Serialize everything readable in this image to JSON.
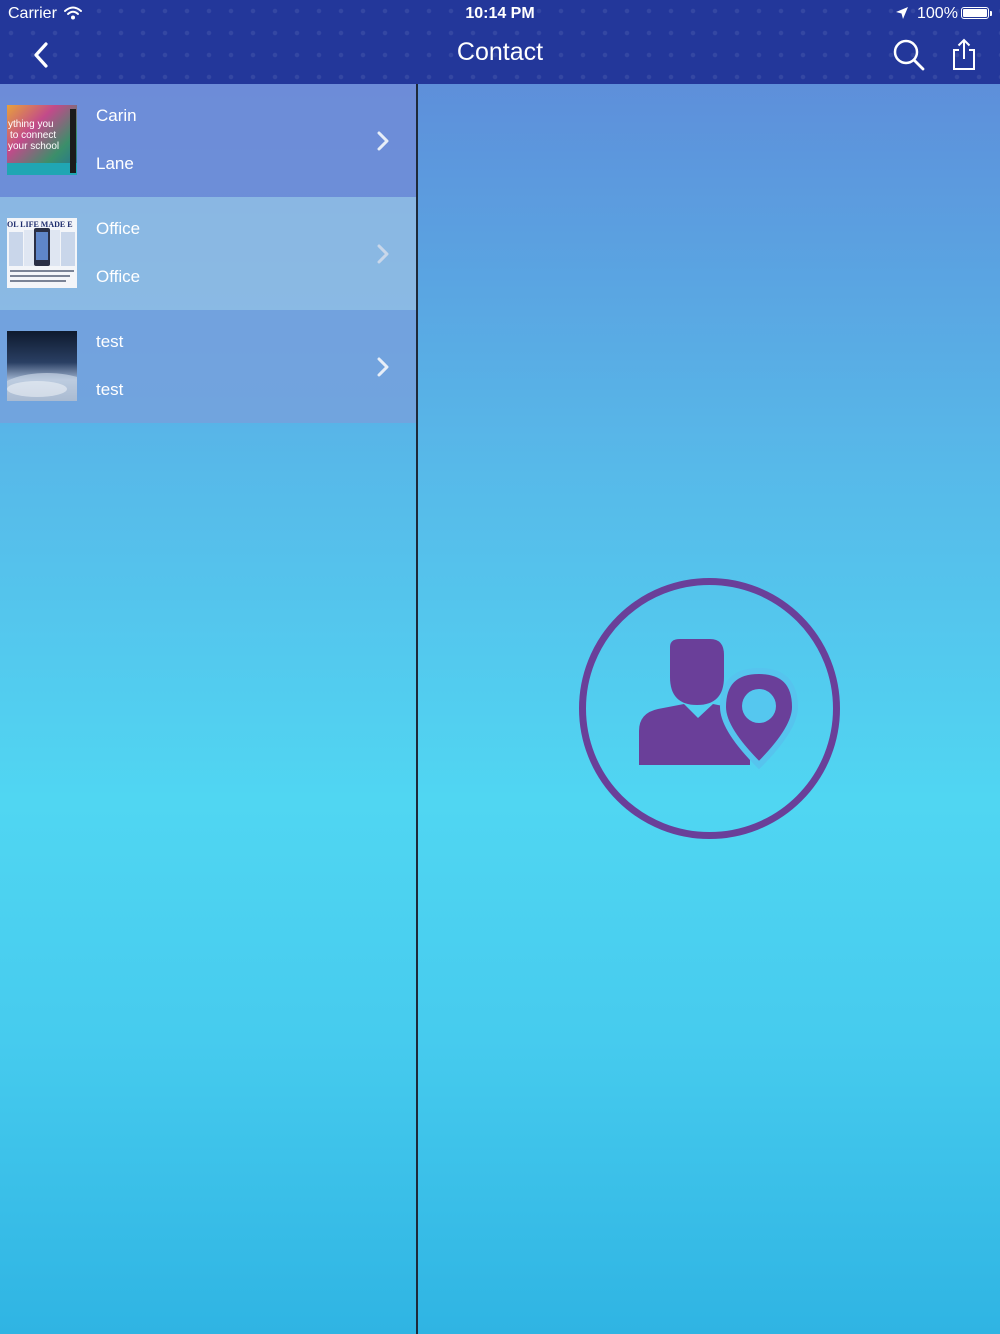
{
  "status_bar": {
    "carrier": "Carrier",
    "time": "10:14 PM",
    "battery": "100%"
  },
  "nav": {
    "title": "Contact",
    "back_icon": "chevron-left-icon",
    "search_icon": "search-icon",
    "share_icon": "share-icon"
  },
  "contacts": [
    {
      "title": "Carin",
      "subtitle": "Lane",
      "thumbnail_text": [
        "ything you",
        "to connect",
        "your school"
      ]
    },
    {
      "title": "Office",
      "subtitle": "Office",
      "thumbnail_text": [
        "OL LIFE MADE E"
      ]
    },
    {
      "title": "test",
      "subtitle": "test"
    }
  ],
  "detail": {
    "emblem_icon": "contact-location-icon"
  },
  "colors": {
    "header": "#23379a",
    "emblem": "#6a3f99"
  }
}
